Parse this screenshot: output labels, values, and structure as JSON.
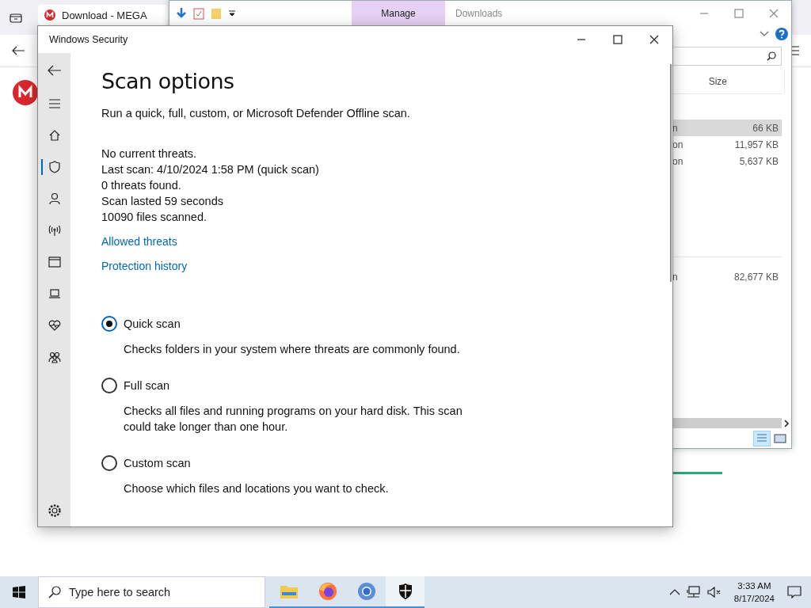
{
  "browser": {
    "tab_title": "Download - MEGA",
    "download_progress": {
      "level": 1
    }
  },
  "explorer": {
    "ribbon_tab": "Manage",
    "title": "Downloads",
    "column_header": "Size",
    "row_groups": [
      {
        "rows": [
          {
            "column_1": "n",
            "size": "66 KB",
            "selected": true
          },
          {
            "column_1": "on",
            "size": "11,957 KB",
            "selected": false
          },
          {
            "column_1": "on",
            "size": "5,637 KB",
            "selected": false
          }
        ]
      },
      {
        "rows": [
          {
            "column_1": "n",
            "size": "82,677 KB",
            "selected": false
          }
        ]
      }
    ]
  },
  "security": {
    "window_title": "Windows Security",
    "nav": [
      {
        "kind": "home",
        "selected": false
      },
      {
        "kind": "shield",
        "selected": true
      },
      {
        "kind": "person",
        "selected": false
      },
      {
        "kind": "wireless",
        "selected": false
      },
      {
        "kind": "window",
        "selected": false
      },
      {
        "kind": "laptop",
        "selected": false
      },
      {
        "kind": "heart",
        "selected": false
      },
      {
        "kind": "family",
        "selected": false
      }
    ],
    "heading": "Scan options",
    "intro": "Run a quick, full, custom, or Microsoft Defender Offline scan.",
    "status_lines": [
      "No current threats.",
      "Last scan: 4/10/2024 1:58 PM (quick scan)",
      "0 threats found.",
      "Scan lasted 59 seconds",
      "10090 files scanned."
    ],
    "links": [
      "Allowed threats",
      "Protection history"
    ],
    "options": [
      {
        "label": "Quick scan",
        "description": "Checks folders in your system where threats are commonly found.",
        "selected": true
      },
      {
        "label": "Full scan",
        "description": "Checks all files and running programs on your hard disk. This scan could take longer than one hour.",
        "selected": false
      },
      {
        "label": "Custom scan",
        "description": "Choose which files and locations you want to check.",
        "selected": false
      }
    ]
  },
  "taskbar": {
    "search_placeholder": "Type here to search",
    "apps": [
      {
        "kind": "folder",
        "selected": false
      },
      {
        "kind": "firefox",
        "selected": false
      },
      {
        "kind": "chrome",
        "selected": false
      },
      {
        "kind": "shield",
        "selected": true
      }
    ],
    "time": "3:33 AM",
    "date": "8/17/2024"
  }
}
